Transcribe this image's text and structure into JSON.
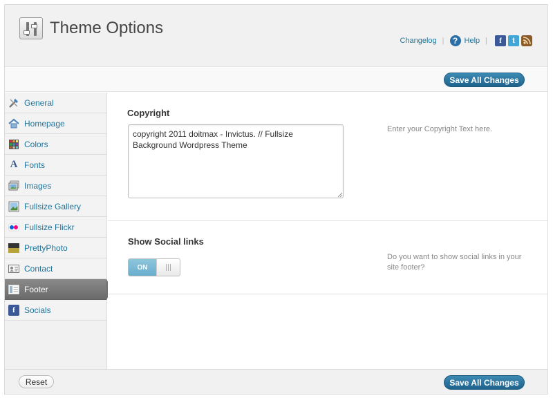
{
  "header": {
    "title": "Theme Options",
    "links": {
      "changelog": "Changelog",
      "help": "Help",
      "separator": "|"
    },
    "icons": [
      "help-icon",
      "facebook-icon",
      "twitter-icon",
      "feed-icon"
    ]
  },
  "toolbar": {
    "save_label": "Save All Changes"
  },
  "sidebar": {
    "items": [
      {
        "label": "General",
        "icon": "tools-icon"
      },
      {
        "label": "Homepage",
        "icon": "home-icon"
      },
      {
        "label": "Colors",
        "icon": "palette-icon"
      },
      {
        "label": "Fonts",
        "icon": "font-icon"
      },
      {
        "label": "Images",
        "icon": "images-icon"
      },
      {
        "label": "Fullsize Gallery",
        "icon": "gallery-icon"
      },
      {
        "label": "Fullsize Flickr",
        "icon": "flickr-icon"
      },
      {
        "label": "PrettyPhoto",
        "icon": "prettyphoto-icon"
      },
      {
        "label": "Contact",
        "icon": "contact-card-icon"
      },
      {
        "label": "Footer",
        "icon": "footer-icon",
        "active": true
      },
      {
        "label": "Socials",
        "icon": "facebook-icon"
      }
    ]
  },
  "main": {
    "copyright": {
      "title": "Copyright",
      "value": "copyright 2011 doitmax - Invictus. // Fullsize Background Wordpress Theme",
      "description": "Enter your Copyright Text here."
    },
    "social": {
      "title": "Show Social links",
      "toggle_label": "ON",
      "toggle_state": true,
      "description": "Do you want to show social links in your site footer?"
    }
  },
  "footer": {
    "reset_label": "Reset",
    "save_label": "Save All Changes"
  },
  "colors": {
    "accent": "#21759b",
    "button": "#2a77a3",
    "active_nav": "#7a7a7a",
    "toggle_on": "#7bbcd6"
  }
}
